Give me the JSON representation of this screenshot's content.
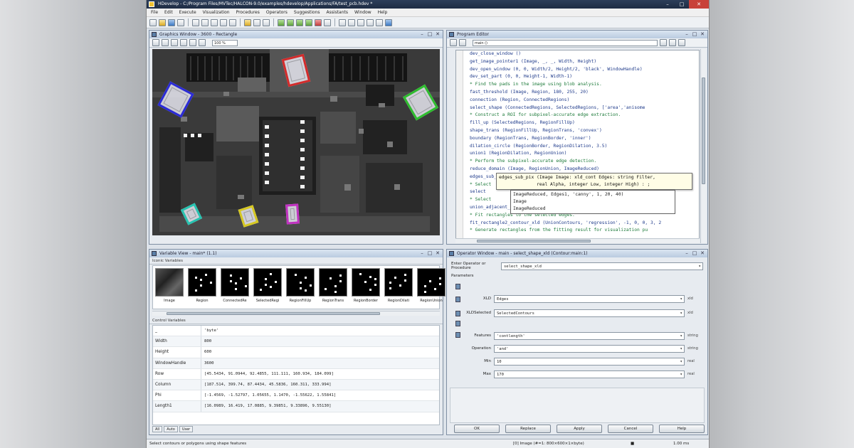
{
  "window": {
    "title": "HDevelop - C:/Program Files/MVTec/HALCON-9.0/examples/hdevelop/Applications/FA/test_pcb.hdev *"
  },
  "menubar": {
    "items": [
      "File",
      "Edit",
      "Execute",
      "Visualization",
      "Procedures",
      "Operators",
      "Suggestions",
      "Assistants",
      "Window",
      "Help"
    ]
  },
  "graphics": {
    "title": "Graphics Window - 3600 - Rectangle",
    "zoom": "100 %"
  },
  "program": {
    "title": "Program Editor",
    "procedure": "main ()",
    "lines": [
      "dev_close_window ()",
      "get_image_pointer1 (Image, _, _, Width, Height)",
      "dev_open_window (0, 0, Width/2, Height/2, 'black', WindowHandle)",
      "dev_set_part (0, 0, Height-1, Width-1)",
      "* Find the pads in the image using blob analysis.",
      "fast_threshold (Image, Region, 180, 255, 20)",
      "connection (Region, ConnectedRegions)",
      "select_shape (ConnectedRegions, SelectedRegions, ['area','anisome",
      "* Construct a ROI for subpixel-accurate edge extraction.",
      "fill_up (SelectedRegions, RegionFillUp)",
      "shape_trans (RegionFillUp, RegionTrans, 'convex')",
      "boundary (RegionTrans, RegionBorder, 'inner')",
      "dilation_circle (RegionBorder, RegionDilation, 3.5)",
      "union1 (RegionDilation, RegionUnion)",
      "* Perform the subpixel-accurate edge detection.",
      "reduce_domain (Image, RegionUnion, ImageReduced)",
      "edges_sub_pix (",
      "* Select",
      "select",
      "* Select",
      "union_adjacent_contours_xld (SelectedEdges, UnionContours, 10, 1, 'attr')",
      "* Fit rectangles to the selected edges.",
      "fit_rectangle2_contour_xld (UnionContours, 'regression', -1, 0, 0, 3, 2",
      "* Generate rectangles from the fitting result for visualization pu"
    ],
    "tooltip": [
      "edges_sub_pix (Image Image: xld_cont Edges: string Filter,",
      "              real Alpha, integer Low, integer High) : ;"
    ],
    "autocomplete": [
      "ImageReduced, Edges1, 'canny', 1, 20, 40)",
      "Image",
      "ImageReduced"
    ]
  },
  "variables": {
    "title": "Variable View - main* (1.1)",
    "iconic_header": "Iconic Variables",
    "iconic": [
      "Image",
      "Region",
      "ConnectedRe",
      "SelectedRegi",
      "RegionFillUp",
      "RegionTrans",
      "RegionBorder",
      "RegionDilati",
      "RegionUnion"
    ],
    "control_header": "Control Variables",
    "control": [
      {
        "name": "_",
        "value": "'byte'"
      },
      {
        "name": "Width",
        "value": "800"
      },
      {
        "name": "Height",
        "value": "600"
      },
      {
        "name": "WindowHandle",
        "value": "3600"
      },
      {
        "name": "Row",
        "value": "[45.5434, 91.0944, 92.4855, 111.111, 160.934, 184.099]"
      },
      {
        "name": "Column",
        "value": "[187.514, 399.74, 87.4434, 45.5836, 160.311, 333.994]"
      },
      {
        "name": "Phi",
        "value": "[-1.4569, -1.52797, 1.05655, 1.1470, -1.55622, 1.55841]"
      },
      {
        "name": "Length1",
        "value": "[16.0989, 16.419, 17.0885, 9.39851, 9.33896, 9.55130]"
      }
    ],
    "tabs": [
      "All",
      "Auto",
      "User"
    ]
  },
  "operator": {
    "title": "Operator Window - main - select_shape_xld (Contour:main:1)",
    "select_label": "Enter Operator or Procedure",
    "select_value": "select_shape_xld",
    "params_header": "Parameters",
    "params": [
      {
        "label": "XLD",
        "value": "Edges",
        "type": "xld"
      },
      {
        "label": "XLDSelected",
        "value": "SelectedContours",
        "type": "xld"
      },
      {
        "label": "Features",
        "value": "'contlength'",
        "type": "string"
      },
      {
        "label": "Operation",
        "value": "'and'",
        "type": "string"
      },
      {
        "label": "Min",
        "value": "10",
        "type": "real"
      },
      {
        "label": "Max",
        "value": "170",
        "type": "real"
      }
    ],
    "buttons": [
      "OK",
      "Replace",
      "Apply",
      "Cancel",
      "Help"
    ]
  },
  "statusbar": {
    "message": "Select contours or polygons using shape features",
    "image_info": "[0] Image (#=1: 800×600×1×byte)",
    "coords": "1.00 ms"
  },
  "colors": {
    "box1": "#2b2bd6",
    "box2": "#d32b2b",
    "box3": "#2fbd2f",
    "box4": "#27c3b0",
    "box5": "#d6c822",
    "box6": "#c032c0"
  }
}
